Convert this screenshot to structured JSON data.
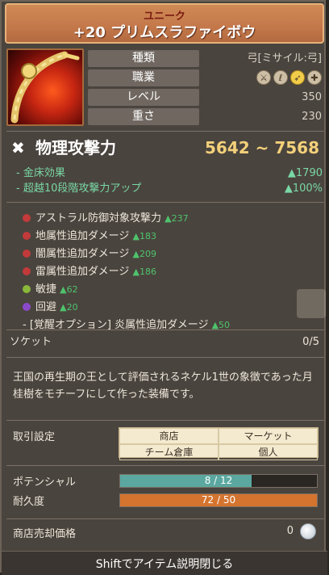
{
  "header": {
    "rarity": "ユニーク",
    "name": "+20 プリムスラファイボウ"
  },
  "info": {
    "type_label": "種類",
    "type_value": "弓[ミサイル:弓]",
    "class_label": "職業",
    "class_icons": [
      "sword-icon",
      "staff-icon",
      "bow-icon",
      "cross-icon"
    ],
    "level_label": "レベル",
    "level_value": "350",
    "weight_label": "重さ",
    "weight_value": "230"
  },
  "attack": {
    "label": "物理攻撃力",
    "value": "5642 ~ 7568"
  },
  "bonuses": [
    {
      "label": "- 金床効果",
      "value": "▲1790"
    },
    {
      "label": "- 超越10段階攻撃力アップ",
      "value": "▲100%"
    }
  ],
  "options": [
    {
      "text": "アストラル防御対象攻撃力",
      "value": "▲237",
      "color": "#c23a3a"
    },
    {
      "text": "地属性追加ダメージ",
      "value": "▲183",
      "color": "#c23a3a"
    },
    {
      "text": "闇属性追加ダメージ",
      "value": "▲209",
      "color": "#c23a3a"
    },
    {
      "text": "雷属性追加ダメージ",
      "value": "▲186",
      "color": "#c23a3a"
    },
    {
      "text": "敏捷",
      "value": "▲62",
      "color": "#8ab83a"
    },
    {
      "text": "回避",
      "value": "▲20",
      "color": "#8a4ac8"
    },
    {
      "text": "- [覚醒オプション] 炎属性追加ダメージ",
      "value": "▲50",
      "color": ""
    }
  ],
  "socket": {
    "label": "ソケット",
    "value": "0/5"
  },
  "description": "王国の再生期の王として評価されるネケル1世の象徴であった月桂樹をモチーフにして作った装備です。",
  "trade": {
    "label": "取引設定",
    "cells": [
      "商店",
      "マーケット",
      "チーム倉庫",
      "個人"
    ]
  },
  "potential": {
    "label": "ポテンシャル",
    "text": "8 / 12",
    "fraction": 0.667
  },
  "durability": {
    "label": "耐久度",
    "text": "72 / 50",
    "fraction": 1.0
  },
  "sell": {
    "label": "商店売却価格",
    "value": "0"
  },
  "footer": {
    "hint": "Shiftでアイテム説明閉じる"
  },
  "colors": {
    "accent": "#f3d07a",
    "green": "#4ec36c",
    "potential_bar": "#5aa8a0",
    "durability_bar": "#d4742e"
  }
}
